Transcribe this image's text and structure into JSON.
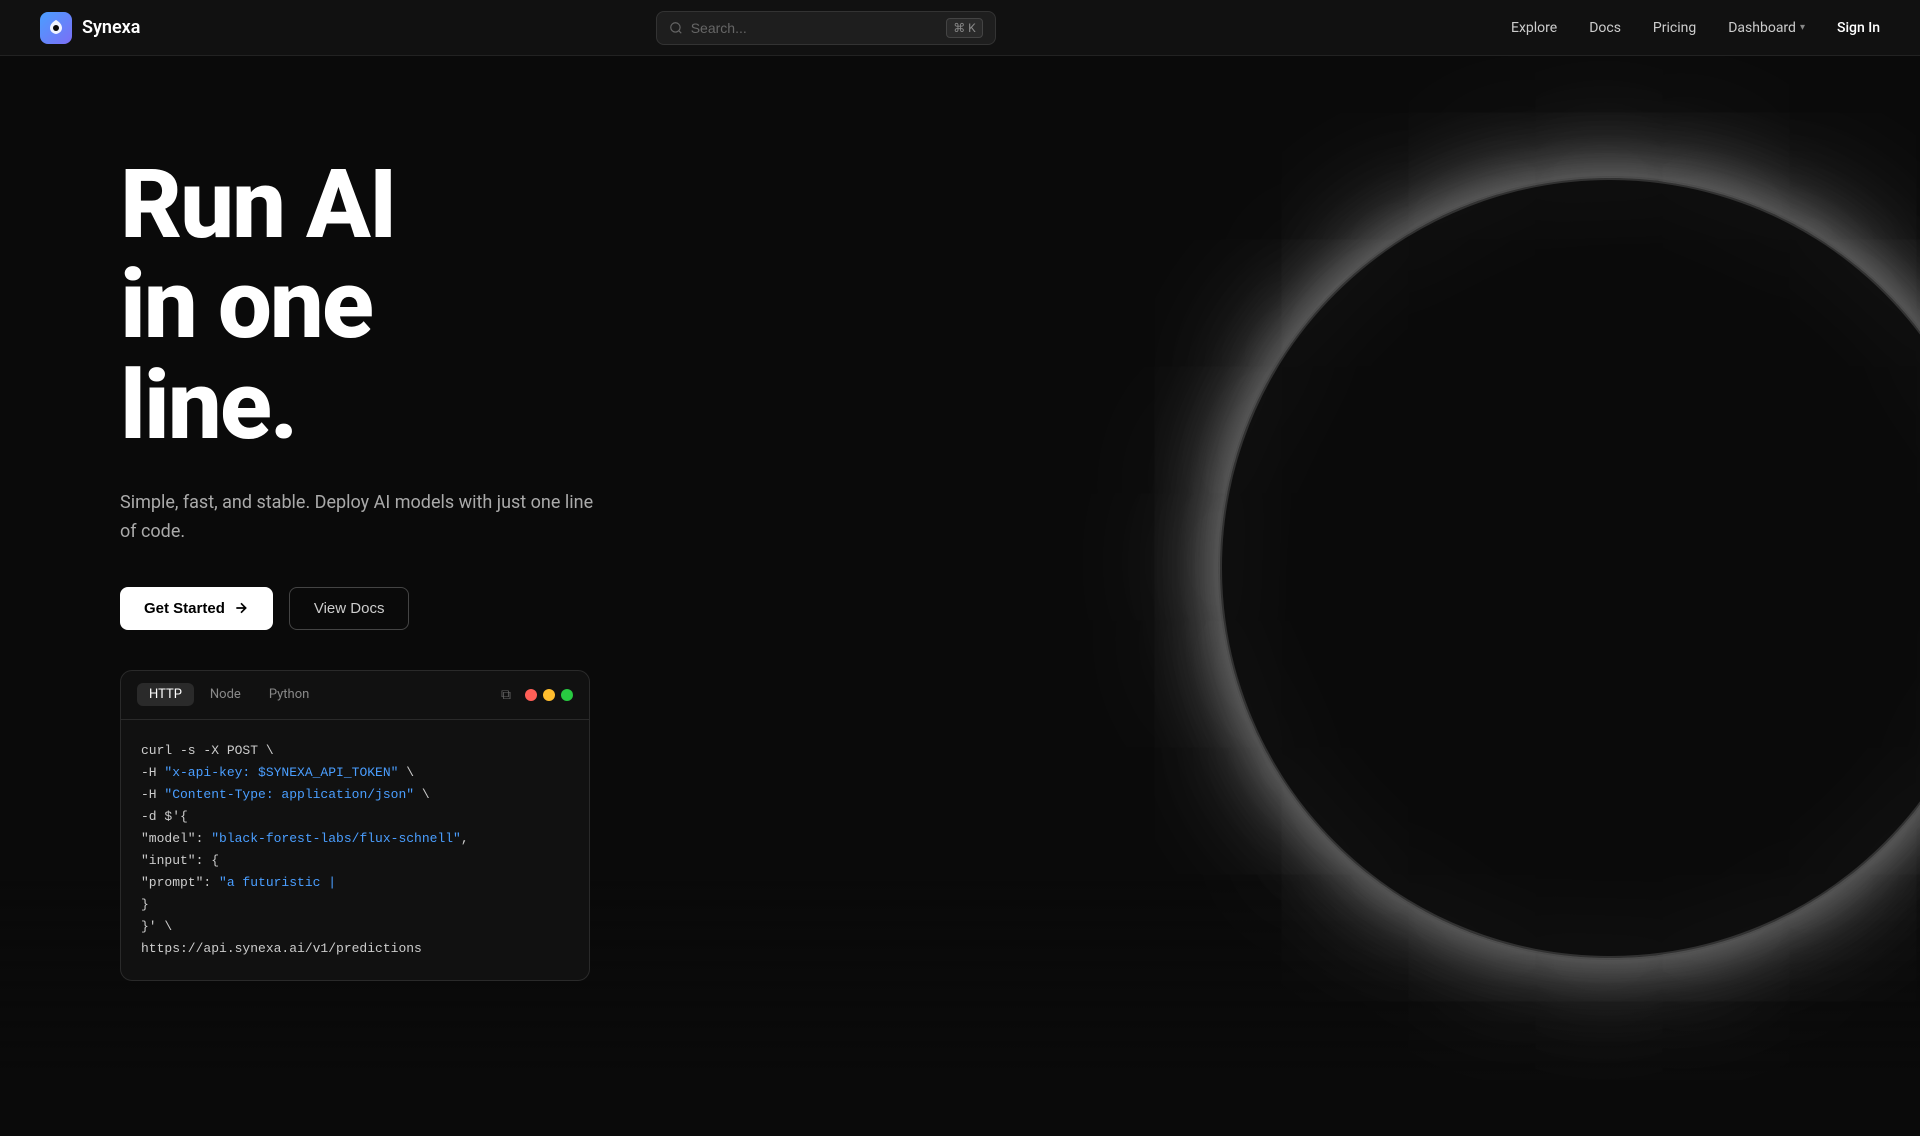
{
  "nav": {
    "logo_icon": "S",
    "logo_text": "Synexa",
    "search_placeholder": "Search...",
    "search_shortcut": "⌘ K",
    "links": [
      {
        "label": "Explore",
        "id": "explore"
      },
      {
        "label": "Docs",
        "id": "docs"
      },
      {
        "label": "Pricing",
        "id": "pricing"
      },
      {
        "label": "Dashboard",
        "id": "dashboard"
      }
    ],
    "dashboard_chevron": "▾",
    "signin_label": "Sign In"
  },
  "hero": {
    "title_line1": "Run AI",
    "title_line2": "in one",
    "title_line3": "line.",
    "subtitle": "Simple, fast, and stable. Deploy AI models with just one line of code.",
    "cta_primary": "Get Started",
    "cta_primary_arrow": "›",
    "cta_secondary": "View Docs"
  },
  "code_block": {
    "tabs": [
      {
        "label": "HTTP",
        "active": true
      },
      {
        "label": "Node",
        "active": false
      },
      {
        "label": "Python",
        "active": false
      }
    ],
    "copy_icon": "⧉",
    "lines": [
      {
        "text": "curl -s -X POST \\",
        "type": "plain"
      },
      {
        "text": "  -H ",
        "type": "plain",
        "string": "\"x-api-key: $SYNEXA_API_TOKEN\"",
        "suffix": " \\"
      },
      {
        "text": "  -H ",
        "type": "plain",
        "string": "\"Content-Type: application/json\"",
        "suffix": " \\"
      },
      {
        "text": "  -d $'{",
        "type": "plain"
      },
      {
        "text": "  \"model\": ",
        "type": "plain",
        "string": "\"black-forest-labs/flux-schnell\"",
        "suffix": ","
      },
      {
        "text": "  \"input\": {",
        "type": "plain"
      },
      {
        "text": "    \"prompt\": ",
        "type": "plain",
        "string": "\"a futuristic |",
        "suffix": ""
      },
      {
        "text": "  }",
        "type": "plain"
      },
      {
        "text": "}' \\",
        "type": "plain"
      },
      {
        "text": "https://api.synexa.ai/v1/predictions",
        "type": "url"
      }
    ]
  }
}
